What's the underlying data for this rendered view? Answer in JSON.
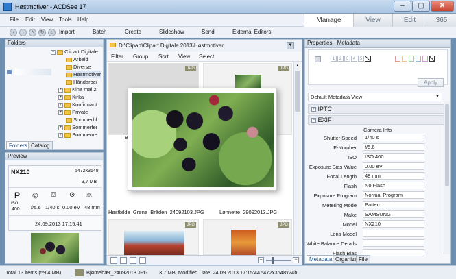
{
  "window": {
    "title": "Høstmotiver - ACDSee 17",
    "controls": [
      "–",
      "▢",
      "✕"
    ]
  },
  "menu": [
    "File",
    "Edit",
    "View",
    "Tools",
    "Help"
  ],
  "modes": [
    "Manage",
    "View",
    "Edit",
    "365"
  ],
  "toolbar": [
    "Import",
    "Batch",
    "Create",
    "Slideshow",
    "Send",
    "External Editors"
  ],
  "folders": {
    "title": "Folders",
    "root": "Clipart Digitale",
    "items": [
      "Arbeid",
      "Diverse",
      "Høstmotiver",
      "Håndarbei",
      "Kina mai 2",
      "Kirka",
      "Konfirmant",
      "Private",
      "Sommerbl",
      "Sommerfer",
      "Sommerne"
    ],
    "tabs": [
      "Folders",
      "Catalog"
    ]
  },
  "preview": {
    "title": "Preview",
    "camera": "NX210",
    "dimensions": "5472x3648",
    "filesize": "3,7 MB",
    "mode": "P",
    "iso_label": "ISO",
    "iso": "400",
    "aperture": "f/5.6",
    "shutter": "1/40 s",
    "exposure": "0.00 eV",
    "focal": "48 mm",
    "datetime": "24.09.2013 17:15:41"
  },
  "browser": {
    "path": "D:\\Clipart\\Clipart Digitale 2013\\Høstmotiver",
    "filters": [
      "Filter",
      "Group",
      "Sort",
      "View",
      "Select"
    ],
    "badge": "JPG",
    "thumb_labels": [
      "Bj",
      "Høstbilde_Grøne_Bråden_24092103.JPG",
      "Lønnetre_29092013.JPG"
    ]
  },
  "properties": {
    "title": "Properties - Metadata",
    "rating_numbers": [
      "1",
      "2",
      "3",
      "4",
      "5"
    ],
    "apply": "Apply",
    "view": "Default Metadata View",
    "sections": [
      "IPTC",
      "EXIF"
    ],
    "exif_header": "Camera Info",
    "exif": [
      {
        "label": "Shutter Speed",
        "value": "1/40 s"
      },
      {
        "label": "F-Number",
        "value": "f/5.6"
      },
      {
        "label": "ISO",
        "value": "ISO 400"
      },
      {
        "label": "Exposure Bias Value",
        "value": "0.00 eV"
      },
      {
        "label": "Focal Length",
        "value": "48 mm"
      },
      {
        "label": "Flash",
        "value": "No Flash"
      },
      {
        "label": "Exposure Program",
        "value": "Normal Program"
      },
      {
        "label": "Metering Mode",
        "value": "Pattern"
      },
      {
        "label": "Make",
        "value": "SAMSUNG"
      },
      {
        "label": "Model",
        "value": "NX210"
      },
      {
        "label": "Lens Model",
        "value": ""
      },
      {
        "label": "White Balance Details",
        "value": ""
      },
      {
        "label": "Flash Bias",
        "value": ""
      }
    ],
    "tabs": [
      "Metadata",
      "Organize",
      "File"
    ]
  },
  "status": {
    "total": "Total 13 items  (59,4 MB)",
    "file": "Bjørnebær_24092013.JPG",
    "info": "3,7 MB, Modified Date: 24.09.2013 17:15:44",
    "dims": "5472x3648x24b"
  }
}
